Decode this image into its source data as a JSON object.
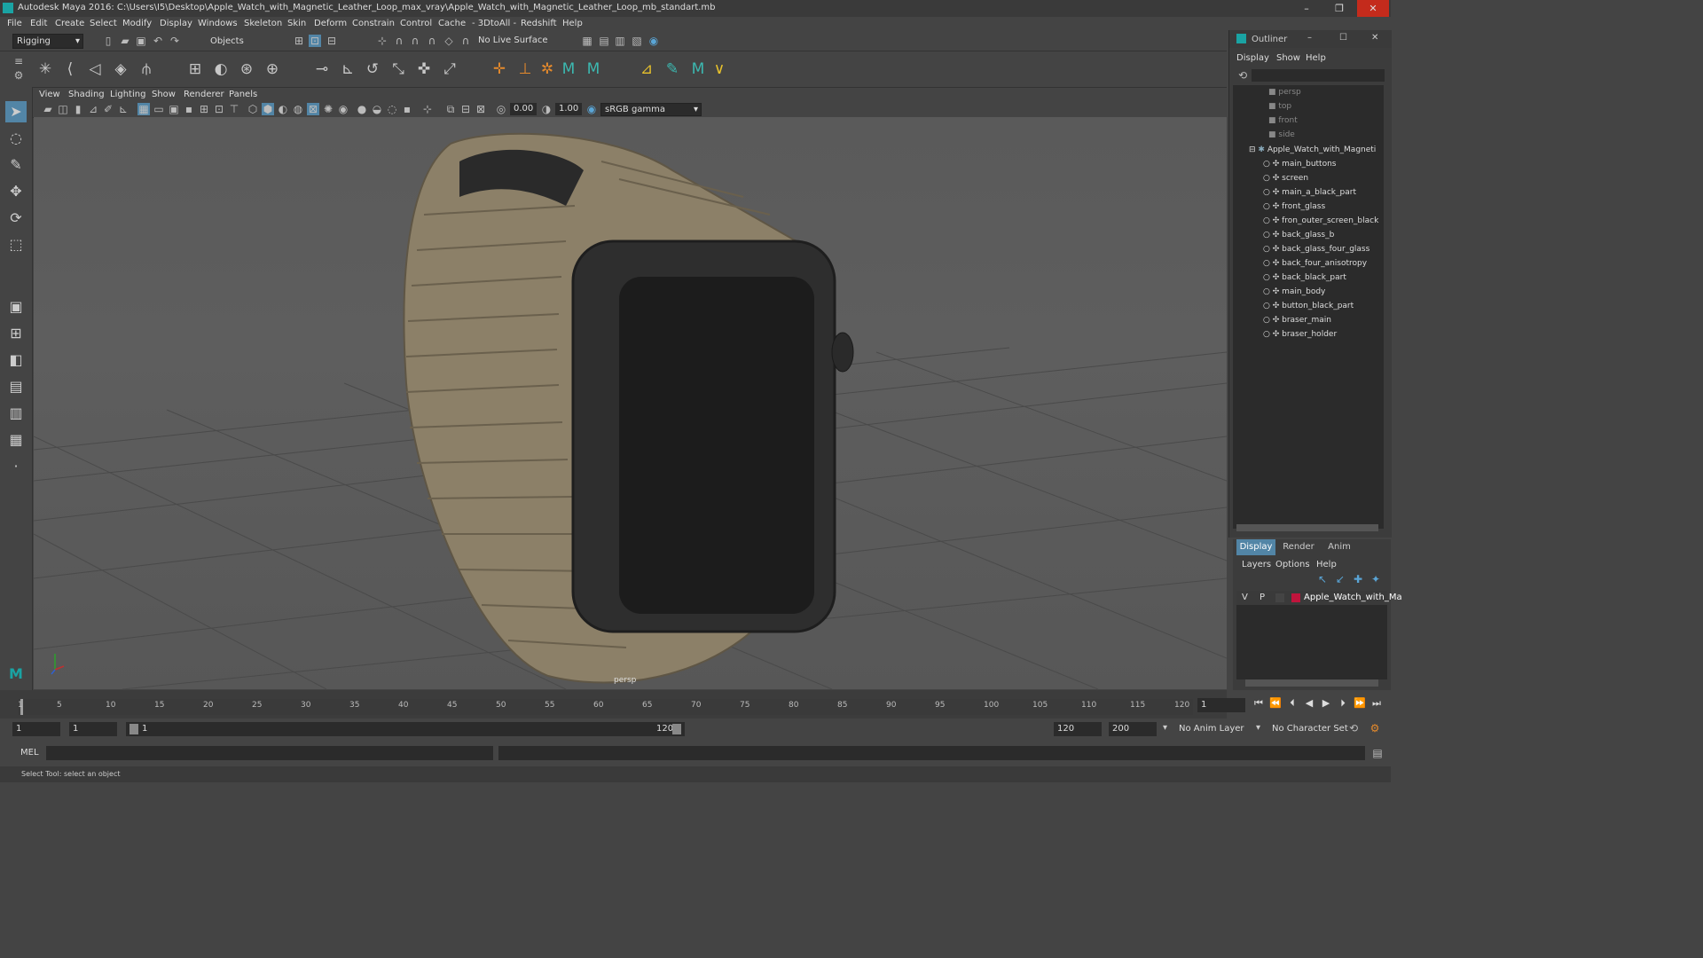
{
  "window": {
    "title": "Autodesk Maya 2016: C:\\Users\\I5\\Desktop\\Apple_Watch_with_Magnetic_Leather_Loop_max_vray\\Apple_Watch_with_Magnetic_Leather_Loop_mb_standart.mb",
    "minimize": "–",
    "restore": "❐",
    "close": "✕"
  },
  "menubar": [
    "File",
    "Edit",
    "Create",
    "Select",
    "Modify",
    "Display",
    "Windows",
    "Skeleton",
    "Skin",
    "Deform",
    "Constrain",
    "Control",
    "Cache",
    "- 3DtoAll -",
    "Redshift",
    "Help"
  ],
  "statusline": {
    "menuset": "Rigging",
    "selection_mode": "Objects",
    "live_surface": "No Live Surface"
  },
  "panel": {
    "menus": [
      "View",
      "Shading",
      "Lighting",
      "Show",
      "Renderer",
      "Panels"
    ],
    "exposure": "0.00",
    "gamma": "1.00",
    "color_space": "sRGB gamma",
    "camera_label": "persp"
  },
  "outliner": {
    "title": "Outliner",
    "menus": [
      "Display",
      "Show",
      "Help"
    ],
    "cameras": [
      "persp",
      "top",
      "front",
      "side"
    ],
    "group": "Apple_Watch_with_Magneti",
    "children": [
      "main_buttons",
      "screen",
      "main_a_black_part",
      "front_glass",
      "fron_outer_screen_black",
      "back_glass_b",
      "back_glass_four_glass",
      "back_four_anisotropy",
      "back_black_part",
      "main_body",
      "button_black_part",
      "braser_main",
      "braser_holder"
    ]
  },
  "layer_editor": {
    "tabs": [
      "Display",
      "Render",
      "Anim"
    ],
    "menus": [
      "Layers",
      "Options",
      "Help"
    ],
    "layer": {
      "v": "V",
      "p": "P",
      "name": "Apple_Watch_with_Ma",
      "color": "#c0143c"
    }
  },
  "timeline": {
    "ticks": [
      "1",
      "5",
      "10",
      "15",
      "20",
      "25",
      "30",
      "35",
      "40",
      "45",
      "50",
      "55",
      "60",
      "65",
      "70",
      "75",
      "80",
      "85",
      "90",
      "95",
      "100",
      "105",
      "110",
      "115",
      "120"
    ],
    "current_frame": "1"
  },
  "range": {
    "start": "1",
    "current": "1",
    "slider_start": "1",
    "slider_end": "120",
    "end": "120",
    "max": "200",
    "anim_layer": "No Anim Layer",
    "character_set": "No Character Set"
  },
  "command_line": {
    "label": "MEL"
  },
  "help_line": "Select Tool: select an object",
  "colors": {
    "accent": "#5285a6",
    "band": "#8c8068",
    "case": "#2a2a2a"
  }
}
